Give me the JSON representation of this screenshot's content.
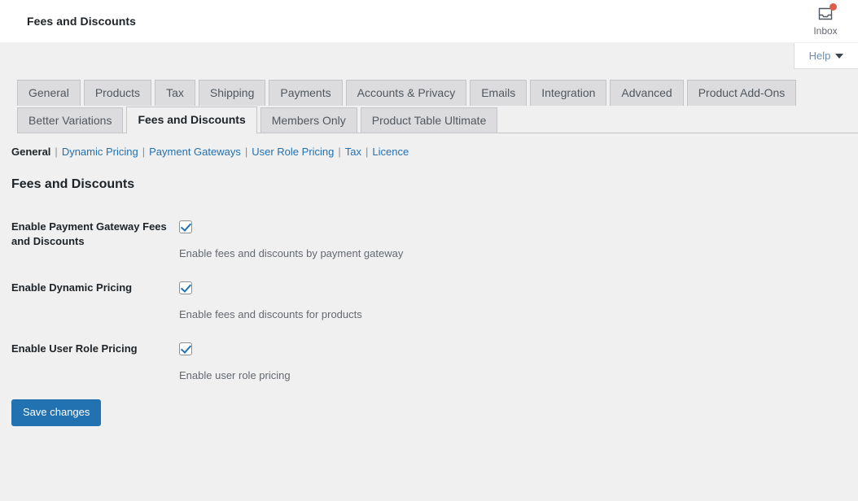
{
  "header": {
    "title": "Fees and Discounts",
    "inbox": {
      "label": "Inbox",
      "icon": "inbox-tray-icon",
      "has_notification": true,
      "dot_color": "#e05c4a"
    }
  },
  "help": {
    "label": "Help",
    "caret_icon": "chevron-down-icon"
  },
  "tabs": {
    "row1": [
      {
        "label": "General",
        "active": false
      },
      {
        "label": "Products",
        "active": false
      },
      {
        "label": "Tax",
        "active": false
      },
      {
        "label": "Shipping",
        "active": false
      },
      {
        "label": "Payments",
        "active": false
      },
      {
        "label": "Accounts & Privacy",
        "active": false
      },
      {
        "label": "Emails",
        "active": false
      },
      {
        "label": "Integration",
        "active": false
      },
      {
        "label": "Advanced",
        "active": false
      },
      {
        "label": "Product Add-Ons",
        "active": false
      }
    ],
    "row2": [
      {
        "label": "Better Variations",
        "active": false
      },
      {
        "label": "Fees and Discounts",
        "active": true
      },
      {
        "label": "Members Only",
        "active": false
      },
      {
        "label": "Product Table Ultimate",
        "active": false
      }
    ]
  },
  "subnav": {
    "separator": "|",
    "items": [
      {
        "label": "General",
        "current": true
      },
      {
        "label": "Dynamic Pricing",
        "current": false
      },
      {
        "label": "Payment Gateways",
        "current": false
      },
      {
        "label": "User Role Pricing",
        "current": false
      },
      {
        "label": "Tax",
        "current": false
      },
      {
        "label": "Licence",
        "current": false
      }
    ]
  },
  "main": {
    "heading": "Fees and Discounts",
    "settings": [
      {
        "label": "Enable Payment Gateway Fees and Discounts",
        "checked": true,
        "description": "Enable fees and discounts by payment gateway"
      },
      {
        "label": "Enable Dynamic Pricing",
        "checked": true,
        "description": "Enable fees and discounts for products"
      },
      {
        "label": "Enable User Role Pricing",
        "checked": true,
        "description": "Enable user role pricing"
      }
    ],
    "save_label": "Save changes"
  },
  "colors": {
    "page_background": "#f0f0f1",
    "accent_blue": "#2271b1",
    "link_blue": "#2271b1",
    "tab_background": "#dcdcde",
    "border": "#c3c4c7",
    "text_dark": "#1d2327",
    "text_muted": "#646970"
  }
}
